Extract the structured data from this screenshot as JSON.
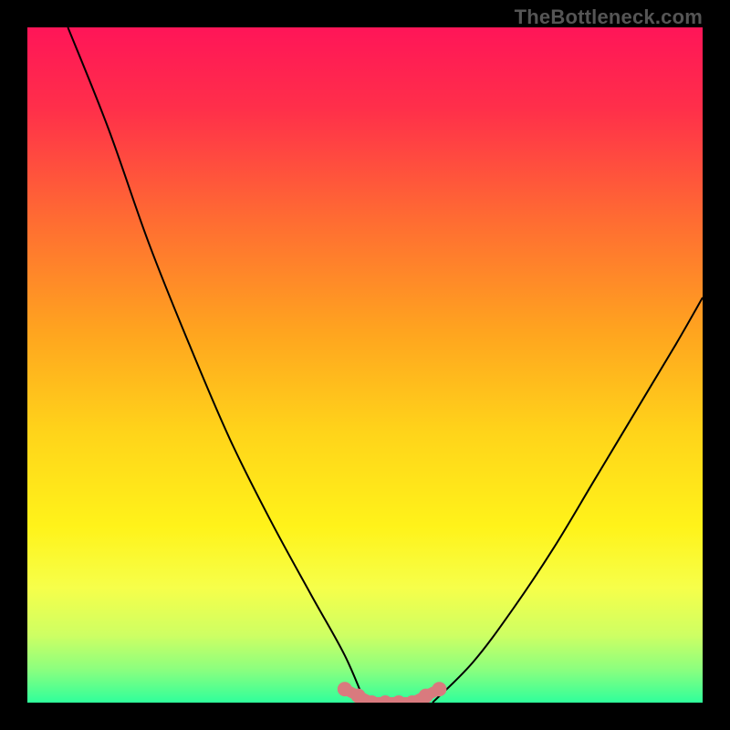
{
  "watermark": "TheBottleneck.com",
  "colors": {
    "frame": "#000000",
    "gradient_stops": [
      {
        "offset": 0.0,
        "color": "#ff1558"
      },
      {
        "offset": 0.12,
        "color": "#ff2f4a"
      },
      {
        "offset": 0.28,
        "color": "#ff6a33"
      },
      {
        "offset": 0.45,
        "color": "#ffa41f"
      },
      {
        "offset": 0.6,
        "color": "#ffd41a"
      },
      {
        "offset": 0.74,
        "color": "#fff31a"
      },
      {
        "offset": 0.83,
        "color": "#f6ff4a"
      },
      {
        "offset": 0.9,
        "color": "#ceff63"
      },
      {
        "offset": 0.95,
        "color": "#8dff7e"
      },
      {
        "offset": 1.0,
        "color": "#2fff9b"
      }
    ],
    "curve": "#000000",
    "marker_fill": "#d97a7e",
    "marker_stroke": "#d97a7e"
  },
  "chart_data": {
    "type": "line",
    "title": "",
    "xlabel": "",
    "ylabel": "",
    "xlim": [
      0,
      100
    ],
    "ylim": [
      0,
      100
    ],
    "grid": false,
    "series": [
      {
        "name": "left-curve",
        "x": [
          6,
          12,
          18,
          24,
          30,
          36,
          42,
          47,
          50
        ],
        "y": [
          100,
          85,
          68,
          53,
          39,
          27,
          16,
          7,
          0
        ]
      },
      {
        "name": "right-curve",
        "x": [
          60,
          66,
          72,
          78,
          84,
          90,
          96,
          100
        ],
        "y": [
          0,
          6,
          14,
          23,
          33,
          43,
          53,
          60
        ]
      }
    ],
    "valley_markers": {
      "name": "bottleneck-valley",
      "x": [
        47,
        49,
        51,
        53,
        55,
        57,
        59,
        61
      ],
      "y": [
        2,
        1,
        0,
        0,
        0,
        0,
        1,
        2
      ]
    },
    "annotations": [
      {
        "text": "TheBottleneck.com",
        "role": "watermark",
        "position": "top-right"
      }
    ]
  }
}
